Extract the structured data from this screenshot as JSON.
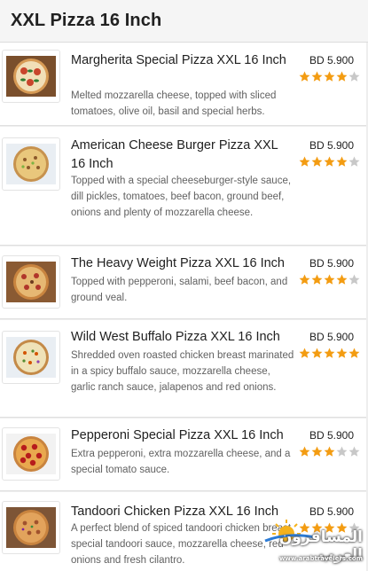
{
  "header": {
    "title": "XXL Pizza 16 Inch"
  },
  "items": [
    {
      "name": "Margherita Special Pizza XXL 16 Inch",
      "description": "Melted mozzarella cheese, topped with sliced tomatoes, olive oil, basil and special herbs.",
      "price": "BD 5.900",
      "rating": 4,
      "max_rating": 5
    },
    {
      "name": "American Cheese Burger Pizza XXL 16 Inch",
      "description": "Topped with a special cheeseburger-style sauce, dill pickles, tomatoes, beef bacon, ground beef, onions and plenty of mozzarella cheese.",
      "price": "BD 5.900",
      "rating": 4,
      "max_rating": 5
    },
    {
      "name": "The Heavy Weight Pizza XXL 16 Inch",
      "description": "Topped with pepperoni, salami, beef bacon, and ground veal.",
      "price": "BD 5.900",
      "rating": 4,
      "max_rating": 5
    },
    {
      "name": "Wild West Buffalo Pizza XXL 16 Inch",
      "description": "Shredded oven roasted chicken breast marinated in a spicy buffalo sauce, mozzarella cheese, garlic ranch sauce, jalapenos and red onions.",
      "price": "BD 5.900",
      "rating": 5,
      "max_rating": 5
    },
    {
      "name": "Pepperoni Special Pizza XXL 16 Inch",
      "description": "Extra pepperoni, extra mozzarella cheese, and a special tomato sauce.",
      "price": "BD 5.900",
      "rating": 3,
      "max_rating": 5
    },
    {
      "name": "Tandoori Chicken Pizza XXL 16 Inch",
      "description": "A perfect blend of spiced tandoori chicken breast, special tandoori sauce, mozzarella cheese, red onions and fresh cilantro.",
      "price": "BD 5.900",
      "rating": 4,
      "max_rating": 5
    }
  ],
  "colors": {
    "star_filled": "#f39c12",
    "star_empty": "#c8c8c8",
    "description_text": "#616161"
  },
  "watermark": {
    "line1": "المسافرون العرب",
    "line2": "www.arabtravelers.com",
    "icon": "sun-logo-icon"
  }
}
